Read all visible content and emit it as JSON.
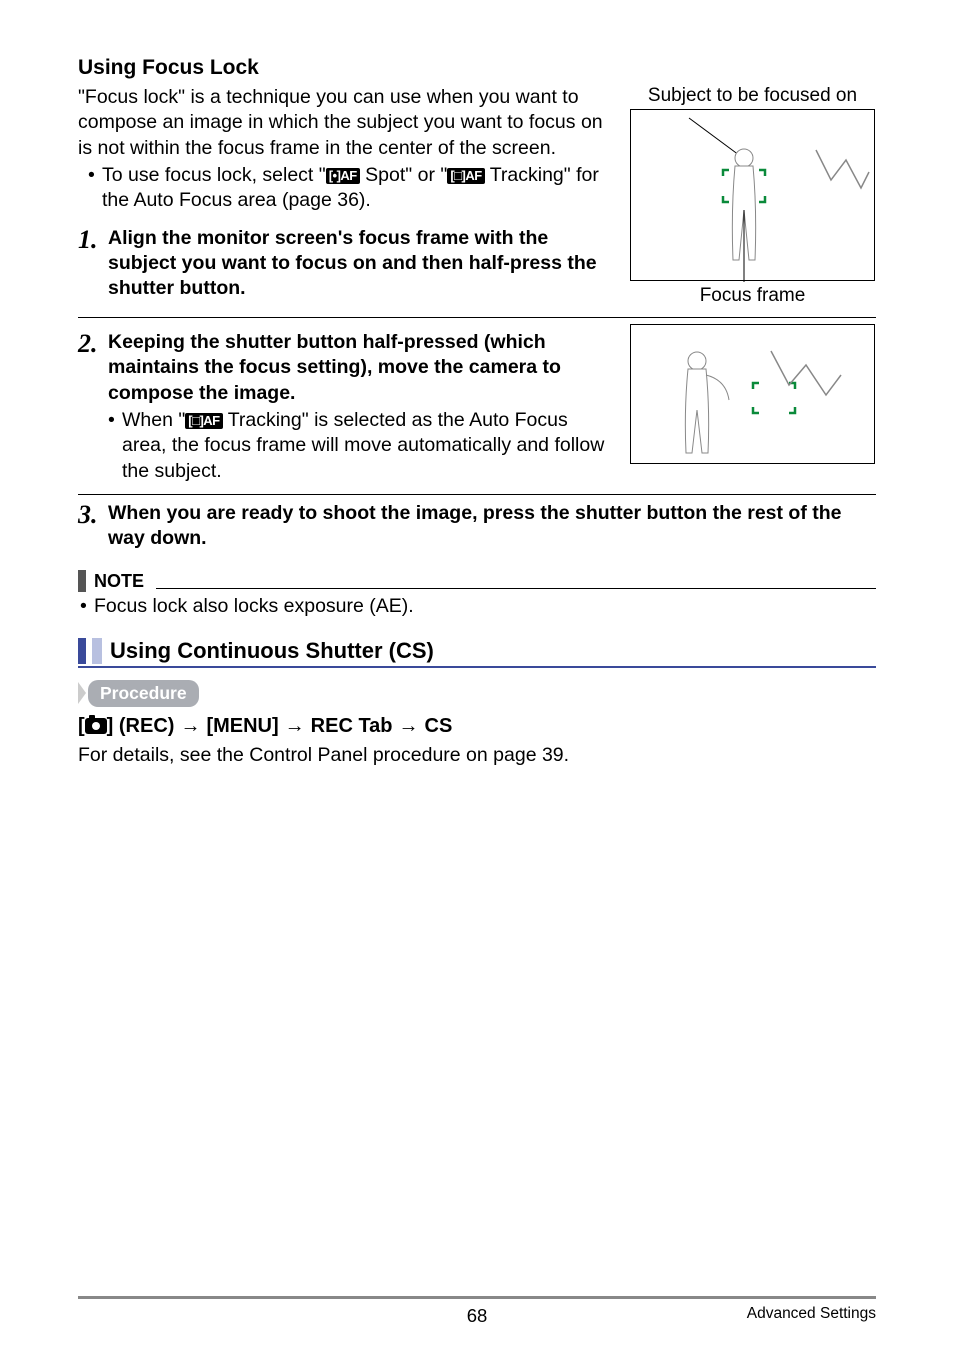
{
  "headings": {
    "focus_lock": "Using Focus Lock",
    "cs_section": "Using Continuous Shutter (CS)"
  },
  "intro": "\"Focus lock\" is a technique you can use when you want to compose an image in which the subject you want to focus on is not within the focus frame in the center of the screen.",
  "bullet_intro": {
    "pre": "To use focus lock, select \"",
    "spot": " Spot\" or \"",
    "tracking": " Tracking\" for the Auto Focus area (page 36)."
  },
  "icons": {
    "spot_af": "[•]AF",
    "track_af": "[□]AF",
    "camera_name": "camera-icon"
  },
  "diagram": {
    "top_label": "Subject to be focused on",
    "bottom_label": "Focus frame"
  },
  "steps": [
    {
      "num": "1.",
      "title": "Align the monitor screen's focus frame with the subject you want to focus on and then half-press the shutter button."
    },
    {
      "num": "2.",
      "title": "Keeping the shutter button half-pressed (which maintains the focus setting), move the camera to compose the image.",
      "sub_pre": "When \"",
      "sub_post": " Tracking\" is selected as the Auto Focus area, the focus frame will move automatically and follow the subject."
    },
    {
      "num": "3.",
      "title": "When you are ready to shoot the image, press the shutter button the rest of the way down."
    }
  ],
  "note": {
    "label": "NOTE",
    "text": "Focus lock also locks exposure (AE)."
  },
  "procedure": {
    "label": "Procedure",
    "path": {
      "lbr": "[",
      "rec": "] (REC)",
      "menu": "[MENU]",
      "tab": "REC Tab",
      "cs": "CS"
    },
    "details": "For details, see the Control Panel procedure on page 39."
  },
  "footer": {
    "page": "68",
    "section": "Advanced Settings"
  }
}
